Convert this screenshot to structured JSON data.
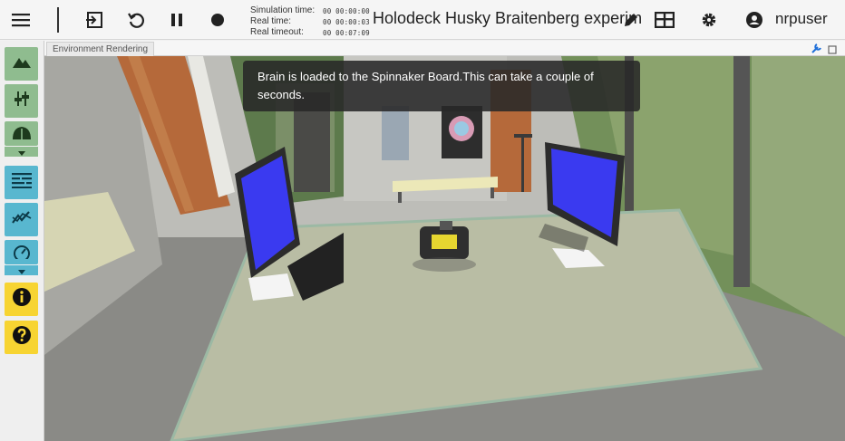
{
  "toolbar": {
    "labels": {
      "sim_time": "Simulation time:",
      "real_time": "Real time:",
      "real_timeout": "Real timeout:"
    },
    "values": {
      "sim_time": "00 00:00:00",
      "real_time": "00 00:00:03",
      "real_timeout": "00 00:07:09"
    },
    "experiment_title": "Holodeck Husky Braitenberg experiment",
    "username": "nrpuser"
  },
  "panel": {
    "tab_label": "Environment Rendering"
  },
  "notification": {
    "text": "Brain is loaded to the Spinnaker Board.This can take a couple of seconds."
  },
  "colors": {
    "green_button": "#8fbc8f",
    "blue_button": "#58b7cf",
    "yellow_button": "#f7d432",
    "screen_blue": "#3a3af0"
  }
}
